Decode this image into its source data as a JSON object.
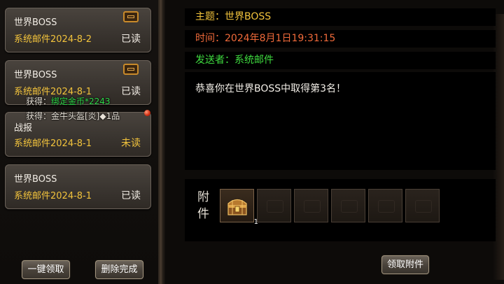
{
  "mail_list": [
    {
      "title": "世界BOSS",
      "sender_date": "系统邮件2024-8-2",
      "status": "已读",
      "has_attachment": true
    },
    {
      "title": "世界BOSS",
      "sender_date": "系统邮件2024-8-1",
      "status": "已读",
      "has_attachment": true
    },
    {
      "title": "战报",
      "sender_date": "系统邮件2024-8-1",
      "status": "未读",
      "has_attachment": false
    },
    {
      "title": "世界BOSS",
      "sender_date": "系统邮件2024-8-1",
      "status": "已读",
      "has_attachment": false
    }
  ],
  "reward_popup": {
    "line1_prefix": "获得：",
    "line1_item": "绑定金币*2243",
    "line2": "获得：金牛头盔[炎]◆1品"
  },
  "buttons": {
    "claim_all": "一键领取",
    "delete_done": "删除完成",
    "claim_attachment": "领取附件"
  },
  "detail": {
    "subject_label": "主题：",
    "subject": "世界BOSS",
    "time_label": "时间：",
    "time": "2024年8月1日19:31:15",
    "sender_label": "发送者：",
    "sender": "系统邮件",
    "body": "恭喜你在世界BOSS中取得第3名！",
    "attachment_label": "附件",
    "attachment_count": "1"
  },
  "colors": {
    "subject": "#f2c33c",
    "time": "#f06a3a",
    "sender": "#3fdc3f",
    "reward_highlight": "#2fd94a"
  }
}
